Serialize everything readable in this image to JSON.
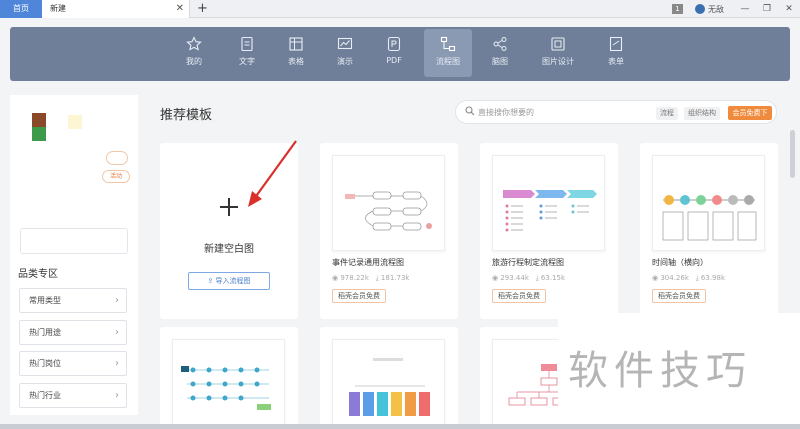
{
  "tabs": {
    "home": "首页",
    "current": "新建",
    "close": "✕",
    "add": "+"
  },
  "titlebar": {
    "badge": "1",
    "username": "无敌",
    "minimize": "—",
    "restore": "❐",
    "close": "✕"
  },
  "categories": [
    {
      "label": "我的",
      "icon": "star-icon"
    },
    {
      "label": "文字",
      "icon": "document-icon"
    },
    {
      "label": "表格",
      "icon": "table-icon"
    },
    {
      "label": "演示",
      "icon": "presentation-icon"
    },
    {
      "label": "PDF",
      "icon": "pdf-icon"
    },
    {
      "label": "流程图",
      "icon": "flowchart-icon",
      "active": true
    },
    {
      "label": "脑图",
      "icon": "mindmap-icon"
    },
    {
      "label": "图片设计",
      "icon": "image-design-icon"
    },
    {
      "label": "表单",
      "icon": "form-icon"
    }
  ],
  "sidebar": {
    "promo_pill": "活动",
    "section_title": "品类专区",
    "items": [
      "常用类型",
      "热门用途",
      "热门岗位",
      "热门行业"
    ]
  },
  "main": {
    "title": "推荐模板",
    "search_placeholder": "直接搜你想要的",
    "search_tags": [
      "流程",
      "组织结构"
    ],
    "free_tag": "会员免费下"
  },
  "blank_card": {
    "label": "新建空白图",
    "import_label": "导入流程图"
  },
  "templates": [
    {
      "title": "事件记录通用流程图",
      "views": "978.22k",
      "downloads": "181.73k",
      "badge": "稻壳会员免费"
    },
    {
      "title": "旅游行程制定流程图",
      "views": "293.44k",
      "downloads": "63.15k",
      "badge": "稻壳会员免费"
    },
    {
      "title": "时间轴（横向）",
      "views": "304.26k",
      "downloads": "63.98k",
      "badge": "稻壳会员免费"
    }
  ],
  "watermark": "软件技巧",
  "colors": {
    "accent": "#4f86d9",
    "catbar": "#6f7f99",
    "free": "#f08a3c",
    "arrow": "#d9302c"
  }
}
